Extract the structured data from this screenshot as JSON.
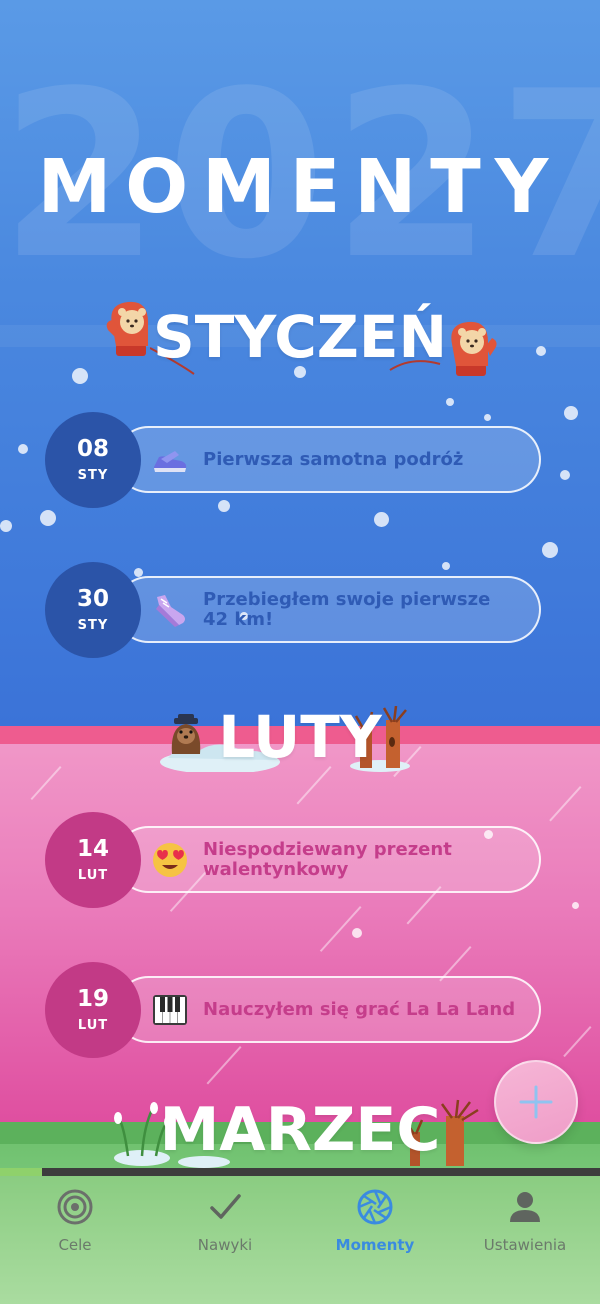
{
  "header": {
    "title": "MOMENTY",
    "year_watermark": "2027"
  },
  "colors": {
    "january_badge": "#2b54a8",
    "january_text": "#2f5bb5",
    "february_badge": "#c23a86",
    "february_text": "#c53d8b",
    "active_nav": "#3a8be0",
    "inactive_nav": "#6b7a6b",
    "fab": "#ef9dc8"
  },
  "months": {
    "january": {
      "title": "STYCZEŃ",
      "moments": [
        {
          "day": "08",
          "month": "STY",
          "icon": "sneaker-icon",
          "text": "Pierwsza samotna podróż"
        },
        {
          "day": "30",
          "month": "STY",
          "icon": "running-shoe-icon",
          "text": "Przebiegłem swoje pierwsze 42 km!"
        }
      ]
    },
    "february": {
      "title": "LUTY",
      "moments": [
        {
          "day": "14",
          "month": "LUT",
          "icon": "heart-eyes-emoji-icon",
          "text": "Niespodziewany prezent walentynkowy"
        },
        {
          "day": "19",
          "month": "LUT",
          "icon": "piano-keys-icon",
          "text": "Nauczyłem się grać La La Land"
        }
      ]
    },
    "march": {
      "title": "MARZEC"
    }
  },
  "fab": {
    "icon": "plus-icon"
  },
  "progress": {
    "fraction": 0.07
  },
  "nav": {
    "items": [
      {
        "label": "Cele",
        "icon": "target-icon",
        "active": false
      },
      {
        "label": "Nawyki",
        "icon": "checkmark-icon",
        "active": false
      },
      {
        "label": "Momenty",
        "icon": "aperture-icon",
        "active": true
      },
      {
        "label": "Ustawienia",
        "icon": "user-icon",
        "active": false
      }
    ]
  }
}
